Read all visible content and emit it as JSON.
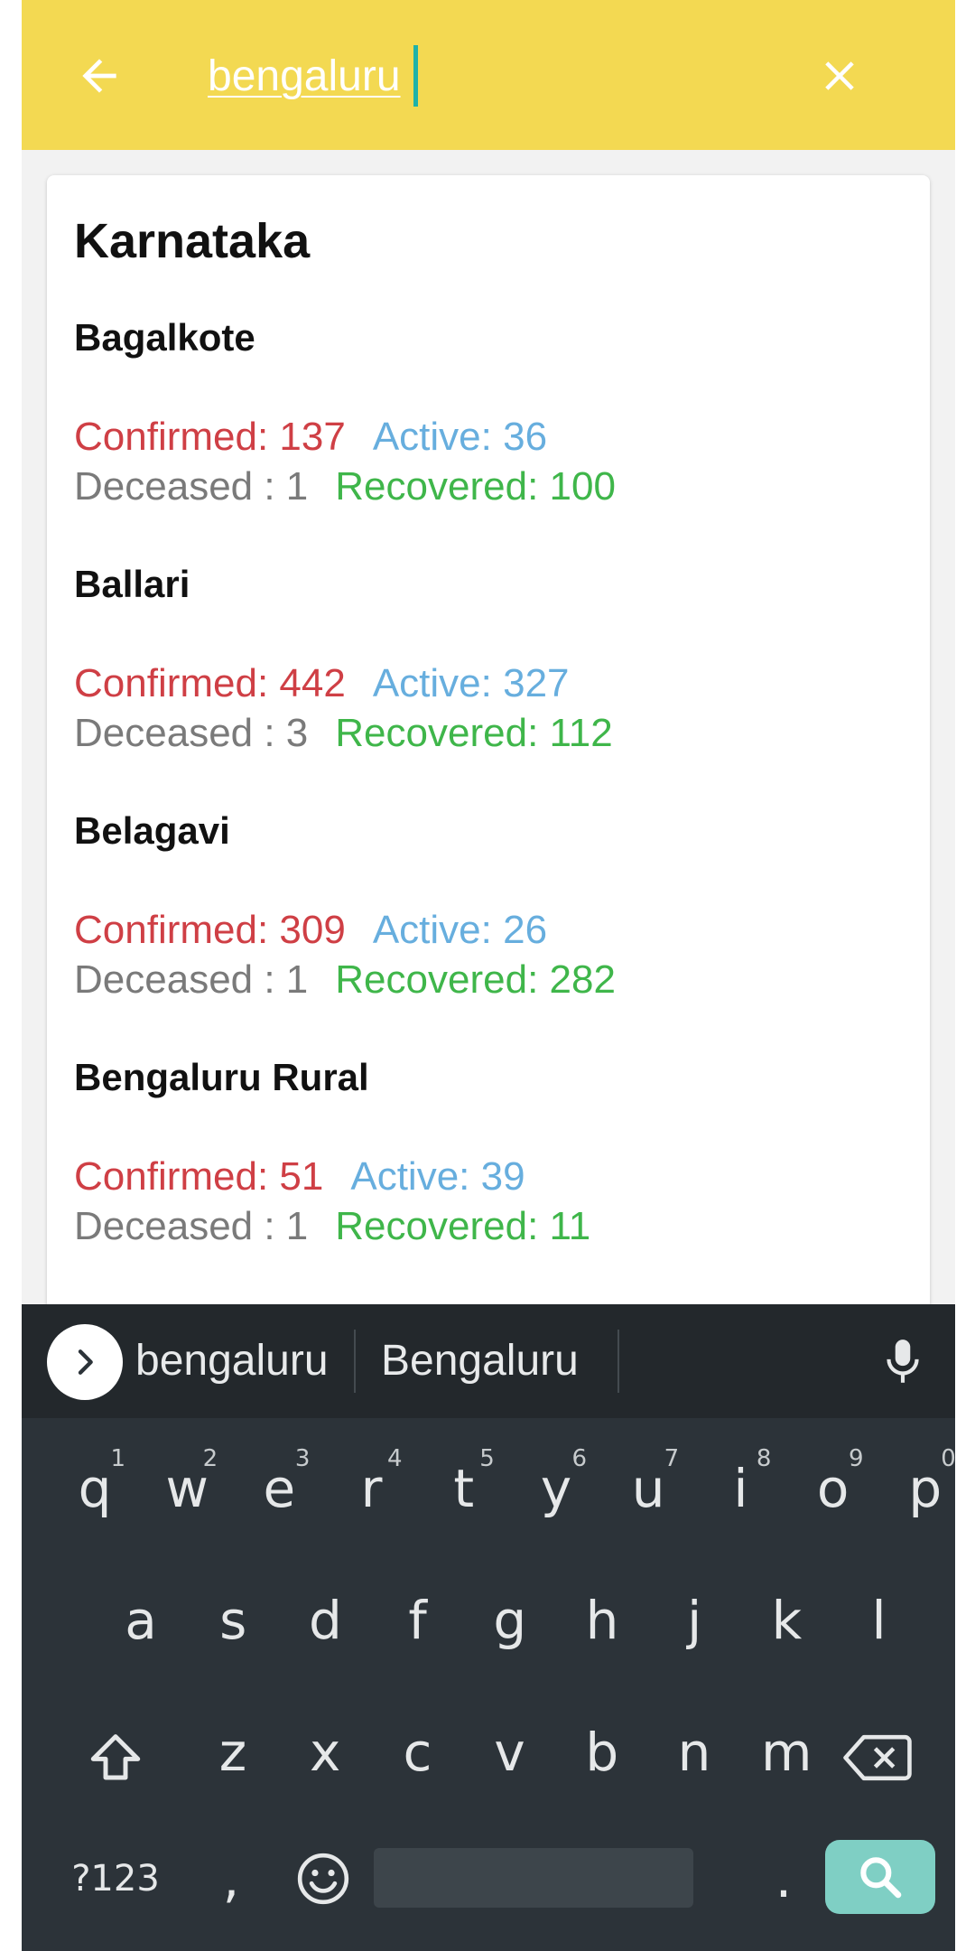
{
  "header": {
    "search_value": "bengaluru",
    "bg_color": "#f3d952"
  },
  "card": {
    "state": "Karnataka",
    "districts": [
      {
        "name": "Bagalkote",
        "confirmed": "Confirmed: 137",
        "active": "Active: 36",
        "deceased": "Deceased : 1",
        "recovered": "Recovered: 100"
      },
      {
        "name": "Ballari",
        "confirmed": "Confirmed: 442",
        "active": "Active: 327",
        "deceased": "Deceased : 3",
        "recovered": "Recovered: 112"
      },
      {
        "name": "Belagavi",
        "confirmed": "Confirmed: 309",
        "active": "Active: 26",
        "deceased": "Deceased : 1",
        "recovered": "Recovered: 282"
      },
      {
        "name": "Bengaluru Rural",
        "confirmed": "Confirmed: 51",
        "active": "Active: 39",
        "deceased": "Deceased : 1",
        "recovered": "Recovered: 11"
      }
    ]
  },
  "colors": {
    "confirmed": "#cf3f45",
    "active": "#67aede",
    "deceased": "#7a7a7a",
    "recovered": "#3fb64a",
    "search_key": "#7fcfc4"
  },
  "keyboard": {
    "suggestions": [
      "bengaluru",
      "Bengaluru"
    ],
    "row1": [
      "q",
      "w",
      "e",
      "r",
      "t",
      "y",
      "u",
      "i",
      "o",
      "p"
    ],
    "row1_hints": [
      "1",
      "2",
      "3",
      "4",
      "5",
      "6",
      "7",
      "8",
      "9",
      "0"
    ],
    "row2": [
      "a",
      "s",
      "d",
      "f",
      "g",
      "h",
      "j",
      "k",
      "l"
    ],
    "row3": [
      "z",
      "x",
      "c",
      "v",
      "b",
      "n",
      "m"
    ],
    "symbols_label": "?123",
    "comma": ",",
    "period": "."
  }
}
